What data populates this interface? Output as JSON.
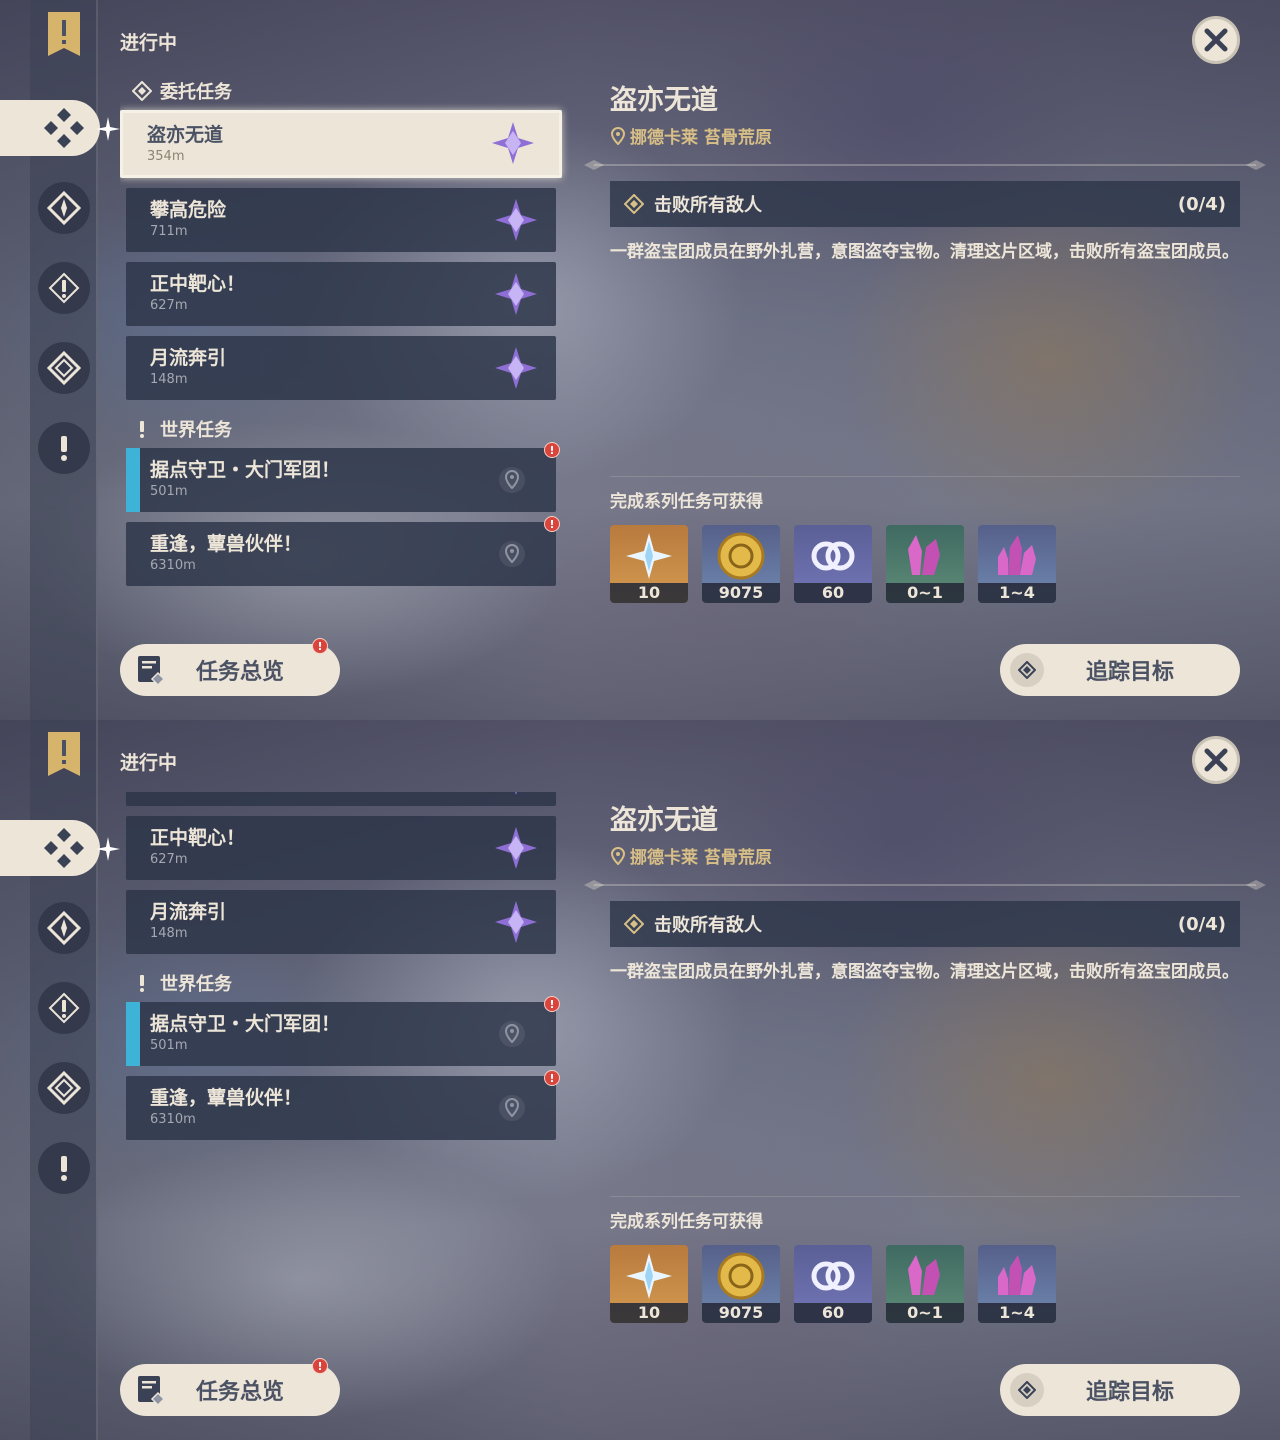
{
  "status_label": "进行中",
  "sections": {
    "commission": "委托任务",
    "world": "世界任务"
  },
  "commissions": [
    {
      "name": "盗亦无道",
      "distance": "354m"
    },
    {
      "name": "攀高危险",
      "distance": "711m"
    },
    {
      "name": "正中靶心！",
      "distance": "627m"
    },
    {
      "name": "月流奔引",
      "distance": "148m"
    }
  ],
  "world_quests": [
    {
      "name": "据点守卫・大门军团！",
      "distance": "501m",
      "alert": "!"
    },
    {
      "name": "重逢，蕈兽伙伴！",
      "distance": "6310m",
      "alert": "!"
    }
  ],
  "overview": {
    "label": "任务总览",
    "alert": "!"
  },
  "detail": {
    "title": "盗亦无道",
    "location": "挪德卡莱 苔骨荒原",
    "objective": "击败所有敌人",
    "progress": "(0/4)",
    "description": "一群盗宝团成员在野外扎营，意图盗夺宝物。清理这片区域，击败所有盗宝团成员。",
    "rewards_label": "完成系列任务可获得",
    "rewards": [
      {
        "icon": "primogem-icon",
        "count": "10"
      },
      {
        "icon": "mora-icon",
        "count": "9075"
      },
      {
        "icon": "companionship-exp-icon",
        "count": "60"
      },
      {
        "icon": "enhancement-ore-icon",
        "count": "0~1"
      },
      {
        "icon": "fine-ore-icon",
        "count": "1~4"
      }
    ]
  },
  "track_button": "追踪目标",
  "colors": {
    "panel_cream": "#ece5d8",
    "dark_text": "#4b5263",
    "location_gold": "#d8bf86",
    "tracked_blue": "#3fb2d8",
    "alert_red": "#d9453c",
    "commission_purple": "#a07ce6"
  }
}
